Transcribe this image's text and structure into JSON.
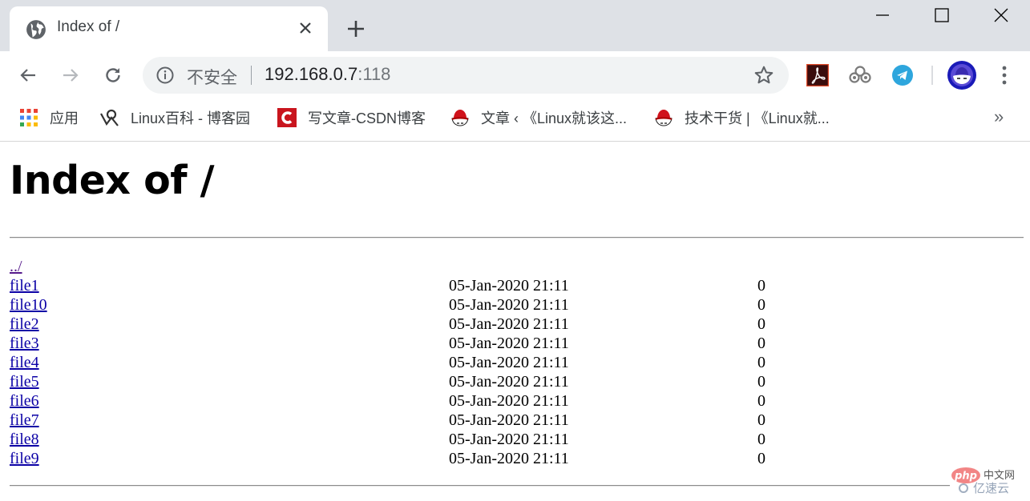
{
  "browser": {
    "tab": {
      "title": "Index of /",
      "favicon": "globe-icon",
      "close_icon": "close-icon"
    },
    "new_tab_icon": "plus-icon",
    "window_controls": [
      "minimize-icon",
      "maximize-icon",
      "close-icon"
    ],
    "toolbar": {
      "back_icon": "arrow-left-icon",
      "forward_icon": "arrow-right-icon",
      "reload_icon": "reload-icon",
      "security_icon": "info-icon",
      "security_label": "不安全",
      "url_host": "192.168.0.7",
      "url_port": ":118",
      "bookmark_icon": "star-icon",
      "extensions": [
        "adobe-acrobat-icon",
        "cloud-link-icon",
        "telegram-icon"
      ],
      "profile_icon": "redhat-avatar-icon",
      "menu_icon": "kebab-menu-icon"
    },
    "bookmarks": [
      {
        "label": "应用",
        "icon": "apps-grid-icon"
      },
      {
        "label": "Linux百科 - 博客园",
        "icon": "cnblogs-icon"
      },
      {
        "label": "写文章-CSDN博客",
        "icon": "csdn-icon"
      },
      {
        "label": "文章 ‹ 《Linux就该这...",
        "icon": "redhat-icon"
      },
      {
        "label": "技术干货 | 《Linux就...",
        "icon": "redhat-icon"
      }
    ],
    "bookmarks_overflow": "»"
  },
  "page": {
    "heading": "Index of /",
    "entries": [
      {
        "name": "../",
        "date": "",
        "size": ""
      },
      {
        "name": "file1",
        "date": "05-Jan-2020 21:11",
        "size": "0"
      },
      {
        "name": "file10",
        "date": "05-Jan-2020 21:11",
        "size": "0"
      },
      {
        "name": "file2",
        "date": "05-Jan-2020 21:11",
        "size": "0"
      },
      {
        "name": "file3",
        "date": "05-Jan-2020 21:11",
        "size": "0"
      },
      {
        "name": "file4",
        "date": "05-Jan-2020 21:11",
        "size": "0"
      },
      {
        "name": "file5",
        "date": "05-Jan-2020 21:11",
        "size": "0"
      },
      {
        "name": "file6",
        "date": "05-Jan-2020 21:11",
        "size": "0"
      },
      {
        "name": "file7",
        "date": "05-Jan-2020 21:11",
        "size": "0"
      },
      {
        "name": "file8",
        "date": "05-Jan-2020 21:11",
        "size": "0"
      },
      {
        "name": "file9",
        "date": "05-Jan-2020 21:11",
        "size": "0"
      }
    ]
  },
  "watermark": {
    "line1_brand": "php",
    "line1_text": "中文网",
    "line2_text": "亿速云"
  },
  "colors": {
    "link": "#0b00a6",
    "visited_link": "#551a8b",
    "tabstrip": "#dee1e6",
    "omnibox": "#f1f3f4"
  }
}
